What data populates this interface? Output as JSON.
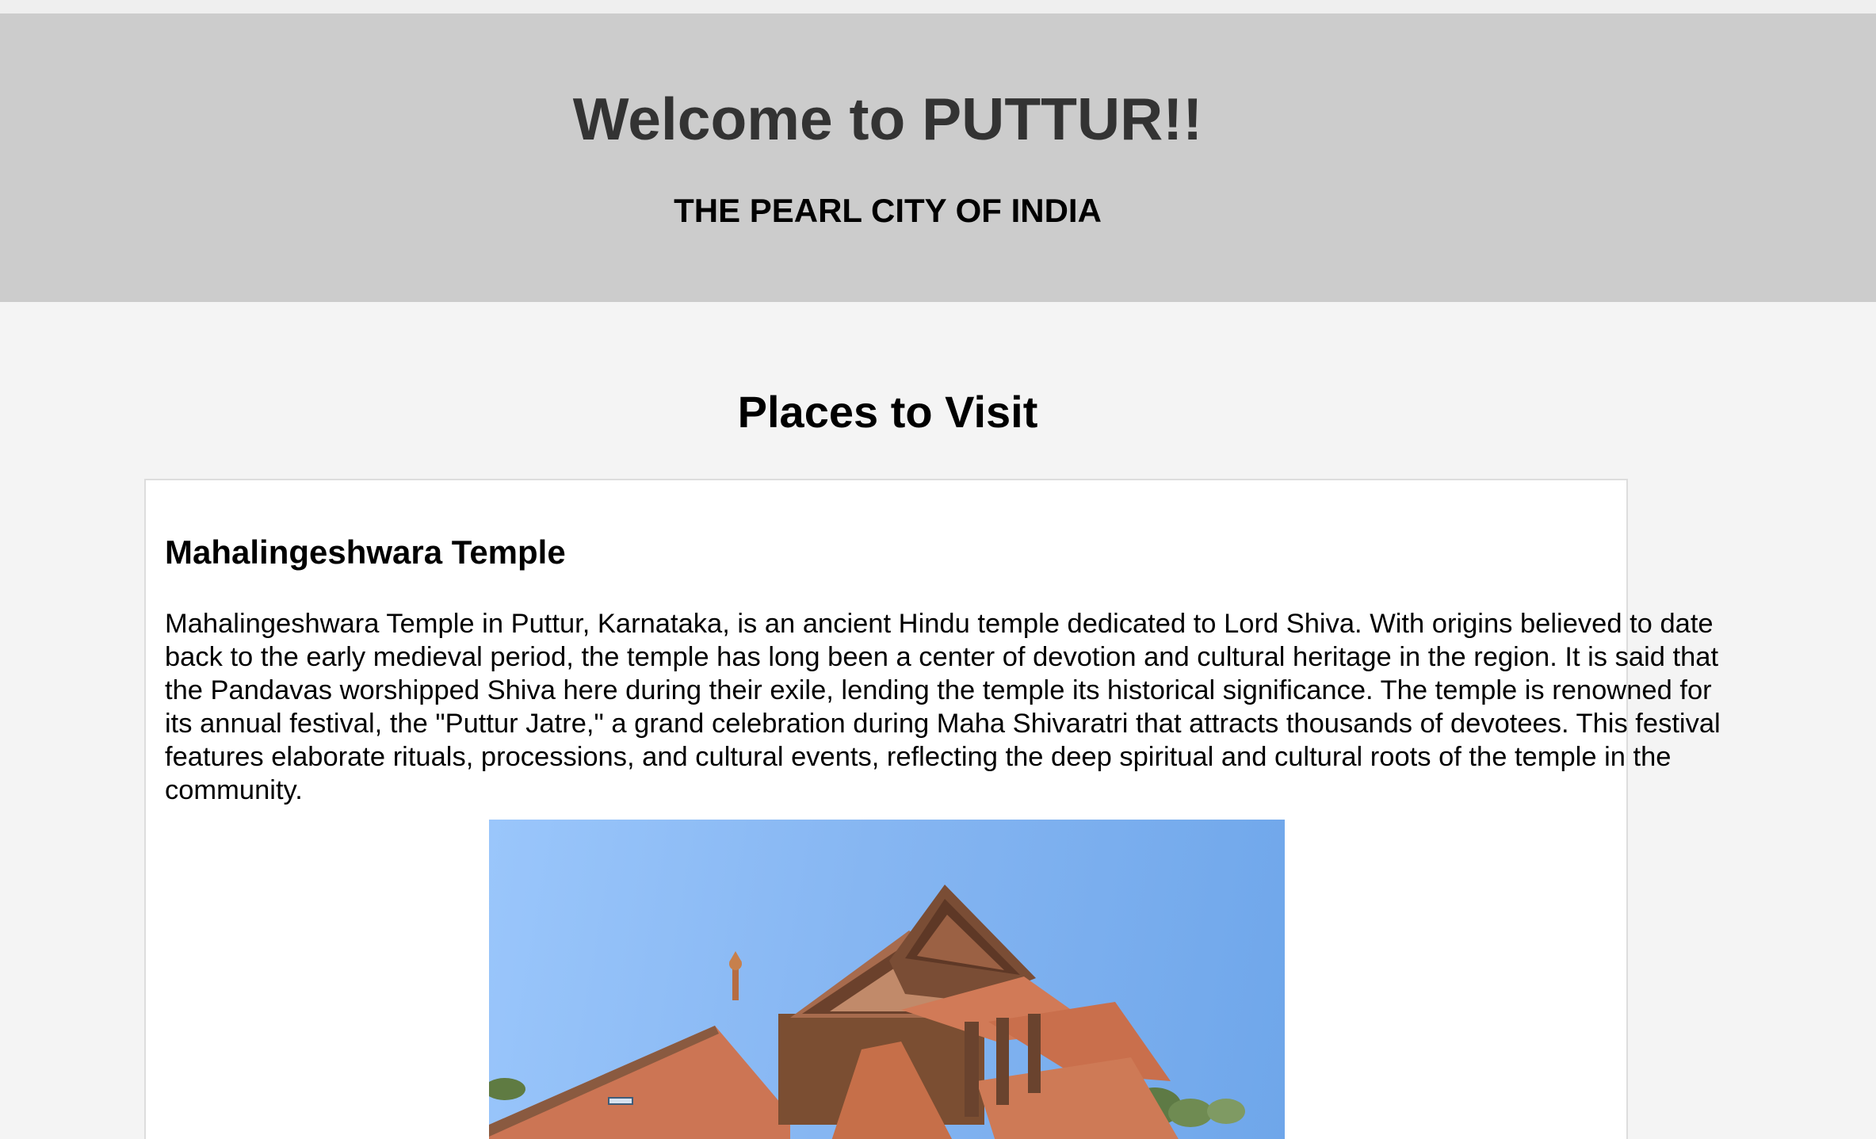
{
  "header": {
    "title": "Welcome to PUTTUR!!",
    "subtitle": "THE PEARL CITY OF INDIA"
  },
  "main": {
    "section_title": "Places to Visit",
    "places": [
      {
        "name": "Mahalingeshwara Temple",
        "description": "Mahalingeshwara Temple in Puttur, Karnataka, is an ancient Hindu temple dedicated to Lord Shiva. With origins believed to date back to the early medieval period, the temple has long been a center of devotion and cultural heritage in the region. It is said that the Pandavas worshipped Shiva here during their exile, lending the temple its historical significance. The temple is renowned for its annual festival, the \"Puttur Jatre,\" a grand celebration during Maha Shivaratri that attracts thousands of devotees. This festival features elaborate rituals, processions, and cultural events, reflecting the deep spiritual and cultural roots of the temple in the community.",
        "image_alt": "Mahalingeshwara Temple photo"
      }
    ]
  },
  "colors": {
    "page_background": "#f4f4f4",
    "header_background": "#cccccc",
    "title_color": "#333333",
    "card_background": "#ffffff",
    "card_border": "#dddddd"
  }
}
